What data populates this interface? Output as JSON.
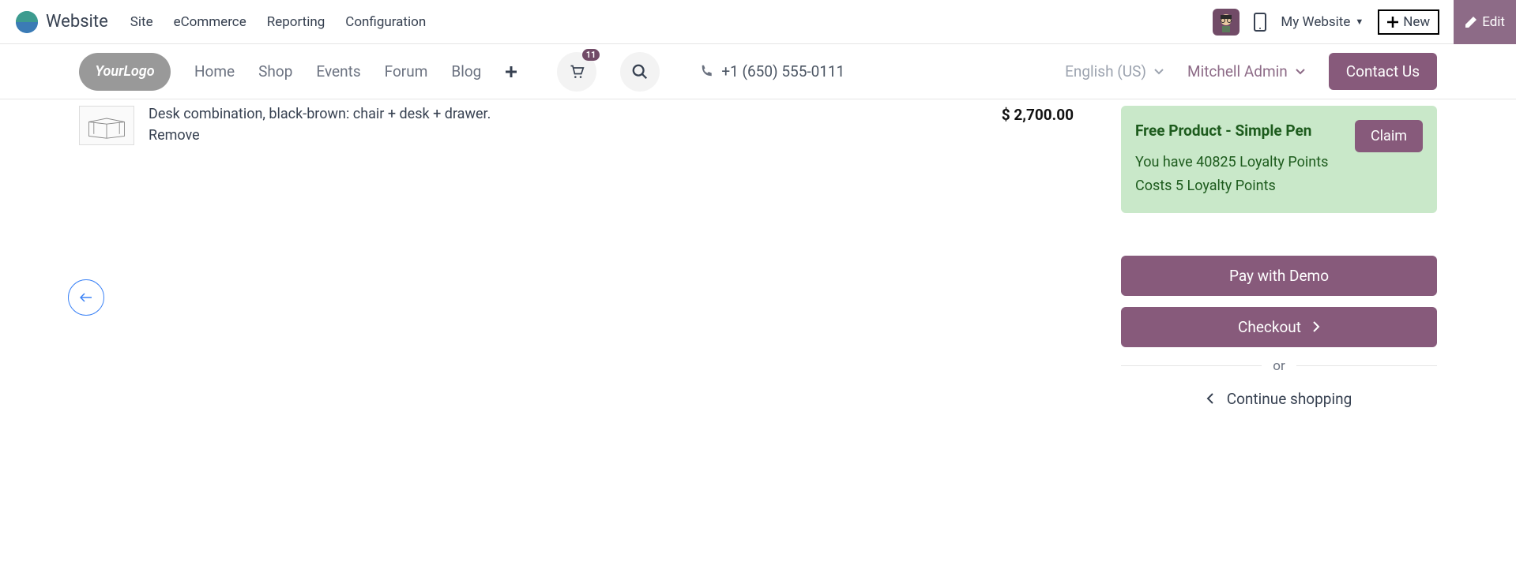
{
  "admin": {
    "brand": "Website",
    "nav": [
      "Site",
      "eCommerce",
      "Reporting",
      "Configuration"
    ],
    "website_selector": "My Website",
    "new_label": "New",
    "edit_label": "Edit"
  },
  "header": {
    "logo_text": "YourLogo",
    "nav": [
      "Home",
      "Shop",
      "Events",
      "Forum",
      "Blog"
    ],
    "cart_count": "11",
    "phone": "+1 (650) 555-0111",
    "language": "English (US)",
    "user": "Mitchell Admin",
    "contact_label": "Contact Us"
  },
  "product": {
    "description": "Desk combination, black-brown: chair + desk + drawer.",
    "remove_label": "Remove",
    "price": "$ 2,700.00"
  },
  "promo": {
    "title": "Free Product - Simple Pen",
    "points_line": "You have 40825 Loyalty Points",
    "cost_line": "Costs 5 Loyalty Points",
    "claim_label": "Claim"
  },
  "checkout": {
    "pay_label": "Pay with Demo",
    "checkout_label": "Checkout",
    "or_label": "or",
    "continue_label": "Continue shopping"
  }
}
